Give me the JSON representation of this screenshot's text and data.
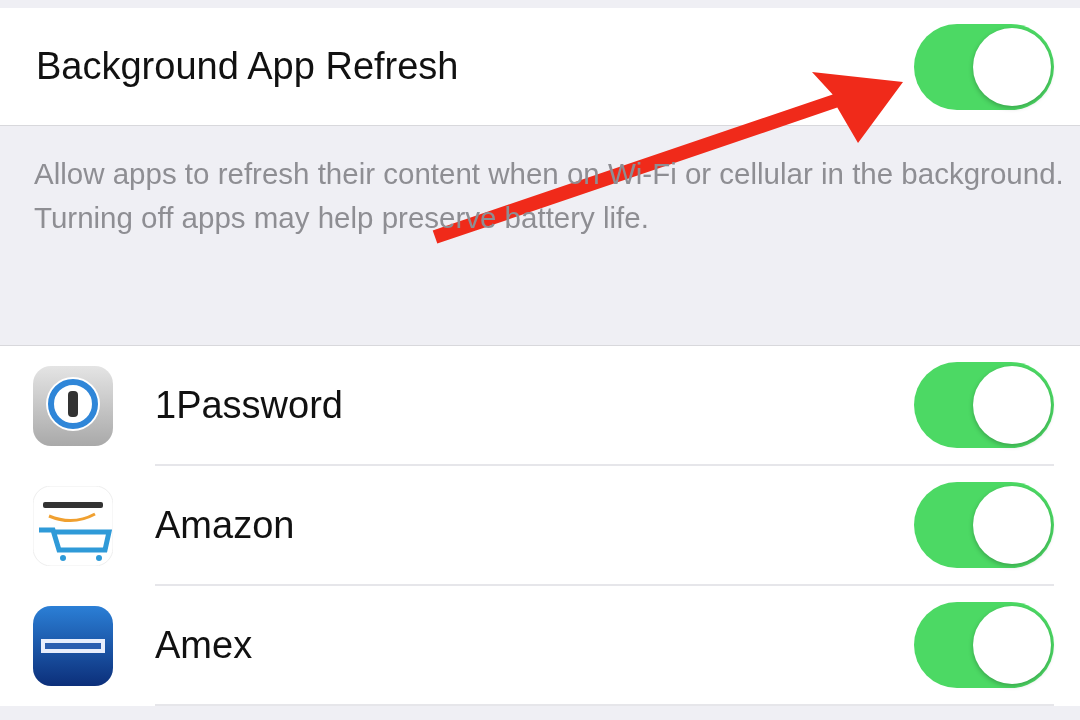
{
  "main_setting": {
    "label": "Background App Refresh",
    "on": true
  },
  "description": "Allow apps to refresh their content when on Wi-Fi or cellular in the background. Turning off apps may help preserve battery life.",
  "apps": [
    {
      "name": "1Password",
      "kind": "password",
      "on": true
    },
    {
      "name": "Amazon",
      "kind": "cart",
      "on": true
    },
    {
      "name": "Amex",
      "kind": "card",
      "on": true
    }
  ]
}
